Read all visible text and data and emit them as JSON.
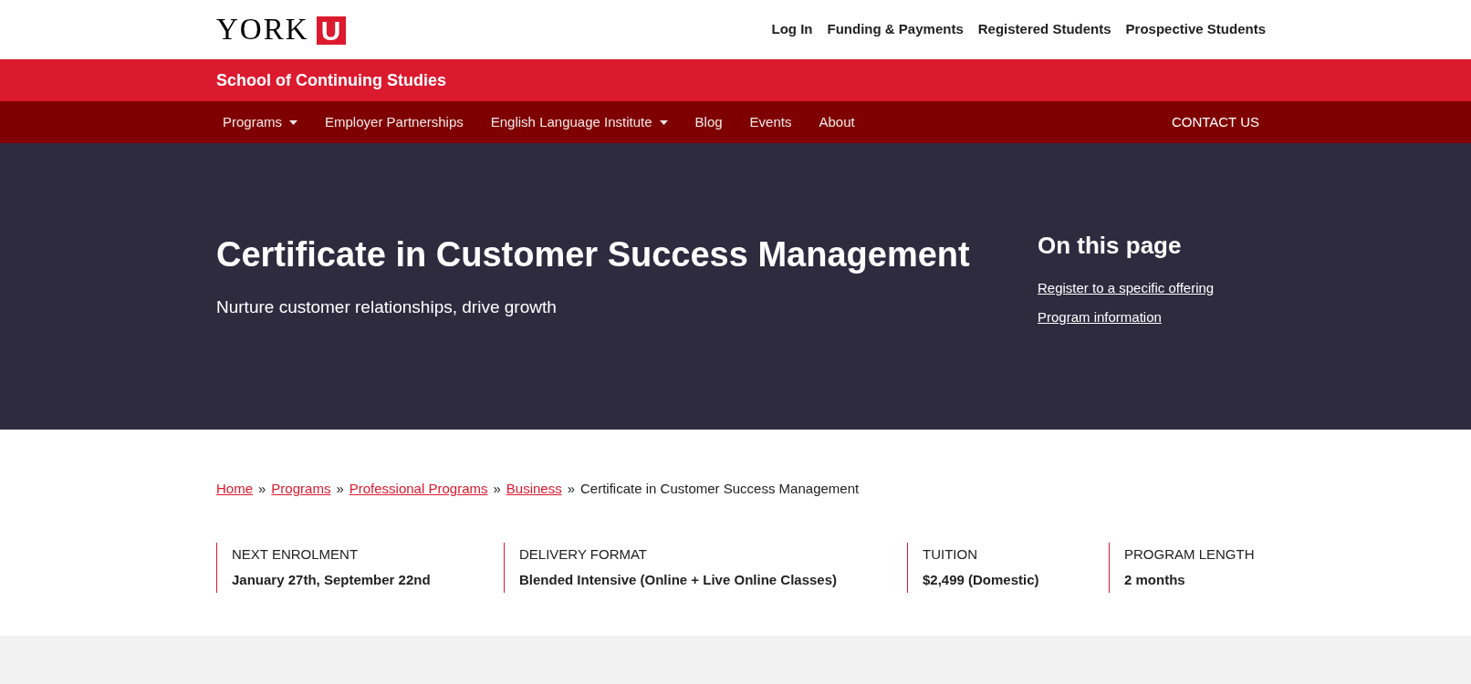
{
  "logo": {
    "wordmark": "YORK",
    "mark": "U"
  },
  "top_links": [
    "Log In",
    "Funding & Payments",
    "Registered Students",
    "Prospective Students"
  ],
  "school_bar": {
    "title": "School of Continuing Studies"
  },
  "nav": {
    "items": [
      {
        "label": "Programs",
        "has_menu": true
      },
      {
        "label": "Employer Partnerships",
        "has_menu": false
      },
      {
        "label": "English Language Institute",
        "has_menu": true
      },
      {
        "label": "Blog",
        "has_menu": false
      },
      {
        "label": "Events",
        "has_menu": false
      },
      {
        "label": "About",
        "has_menu": false
      }
    ],
    "contact": "CONTACT US"
  },
  "hero": {
    "title": "Certificate in Customer Success Management",
    "subtitle": "Nurture customer relationships, drive growth",
    "on_this_page": {
      "heading": "On this page",
      "links": [
        "Register to a specific offering",
        "Program information"
      ]
    }
  },
  "breadcrumb": [
    {
      "label": "Home",
      "link": true
    },
    {
      "label": "Programs",
      "link": true
    },
    {
      "label": "Professional Programs",
      "link": true
    },
    {
      "label": "Business",
      "link": true
    },
    {
      "label": "Certificate in Customer Success Management",
      "link": false
    }
  ],
  "breadcrumb_separator": "»",
  "facts": [
    {
      "label": "NEXT ENROLMENT",
      "value": "January 27th, September 22nd"
    },
    {
      "label": "DELIVERY FORMAT",
      "value": "Blended Intensive (Online + Live Online Classes)"
    },
    {
      "label": "TUITION",
      "value": "$2,499 (Domestic)"
    },
    {
      "label": "PROGRAM LENGTH",
      "value": "2 months"
    }
  ]
}
